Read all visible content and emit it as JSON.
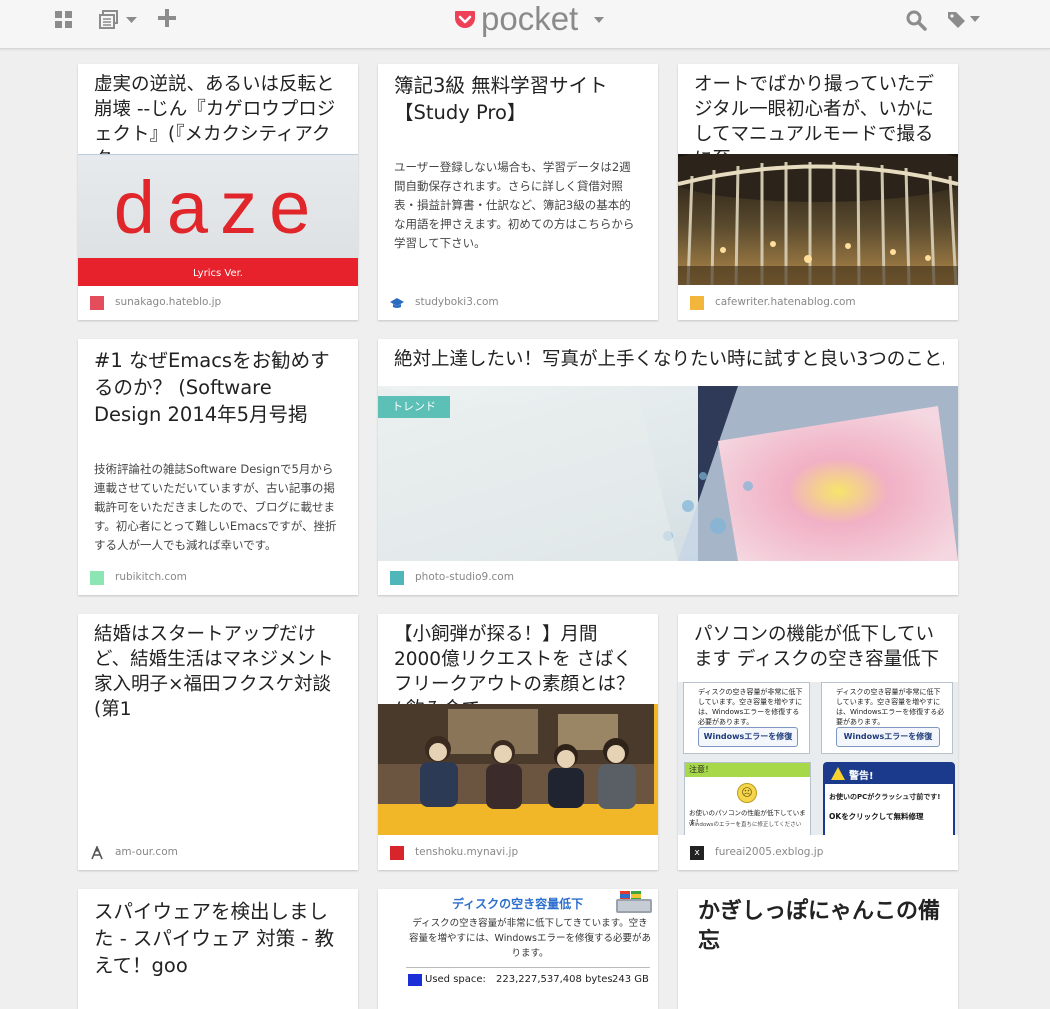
{
  "topbar": {
    "brand_name": "pocket",
    "icons": [
      "grid-icon",
      "list-icon",
      "plus-icon",
      "search-icon",
      "tag-icon",
      "chevron-down-icon"
    ],
    "brand_color": "#ee4056"
  },
  "cards": [
    {
      "title": "虚実の逆説、あるいは反転と崩壊 --じん『カゲロウプロジェクト』(『メカクシティアクター",
      "domain": "sunakago.hateblo.jp",
      "thumb_text": "daze",
      "thumb_sub": "Lyrics Ver.",
      "favicon_color": "#e34d5c"
    },
    {
      "title": "簿記3級 無料学習サイト【Study Pro】",
      "excerpt": "ユーザー登録しない場合も、学習データは2週間自動保存されます。さらに詳しく貸借対照表・損益計算書・仕訳など、簿記3級の基本的な用語を押さえます。初めての方はこちらから学習して下さい。",
      "domain": "studyboki3.com",
      "favicon_color": "#2b6cc0"
    },
    {
      "title": "オートでばかり撮っていたデジタル一眼初心者が、いかにしてマニュアルモードで撮るに至っ",
      "domain": "cafewriter.hatenablog.com",
      "favicon_color": "#f3b63c"
    },
    {
      "title": "#1 なぜEmacsをお勧めするのか？ (Software Design 2014年5月号掲",
      "excerpt": "技術評論社の雑誌Software Designで5月から連載させていただいていますが、古い記事の掲載許可をいただきましたので、ブログに載せます。初心者にとって難しいEmacsですが、挫折する人が一人でも減れば幸いです。",
      "domain": "rubikitch.com",
      "favicon_color": "#8ce6b4"
    },
    {
      "title": "絶対上達したい！写真が上手くなりたい時に試すと良い3つのこと。",
      "badge": "トレンド",
      "domain": "photo-studio9.com",
      "favicon_color": "#4fb7ba"
    },
    {
      "title": "結婚はスタートアップだけど、結婚生活はマネジメント 家入明子×福田フクスケ対談(第1",
      "domain": "am-our.com",
      "favicon_color": "#555555"
    },
    {
      "title": "【小飼弾が探る！】月間2000億リクエストを さばくフリークアウトの素顔とは？ / 飲み会で",
      "domain": "tenshoku.mynavi.jp",
      "favicon_color": "#d8242b"
    },
    {
      "title": "パソコンの機能が低下しています ディスクの空き容量低下",
      "domain": "fureai2005.exblog.jp",
      "favicon_color": "#222222",
      "thumb": {
        "box_text": "ディスクの空き容量が非常に低下しています。空き容量を増やすには、Windowsエラーを修復する必要があります。",
        "button": "Windowsエラーを修復",
        "warning_left": "注意！",
        "warning_left_text": "お使いのパソコンの性能が低下しています！",
        "warning_left_sub": "Windowsのエラーを直ちに修正してください",
        "warning_right": "警告!",
        "warning_right_text": "お使いのPCがクラッシュ寸前です!",
        "warning_right_sub": "OKをクリックして無料修理"
      }
    },
    {
      "title": "スパイウェアを検出しました - スパイウェア 対策 - 教えて！goo"
    },
    {
      "thumb": {
        "heading": "ディスクの空き容量低下",
        "text": "ディスクの空き容量が非常に低下してきています。空き容量を増やすには、Windowsエラーを修復する必要があります。",
        "used_label": "Used space:",
        "used_bytes": "223,227,537,408 bytes",
        "used_gb": "243 GB"
      }
    },
    {
      "title": "かぎしっぽにゃんこの備忘"
    }
  ]
}
